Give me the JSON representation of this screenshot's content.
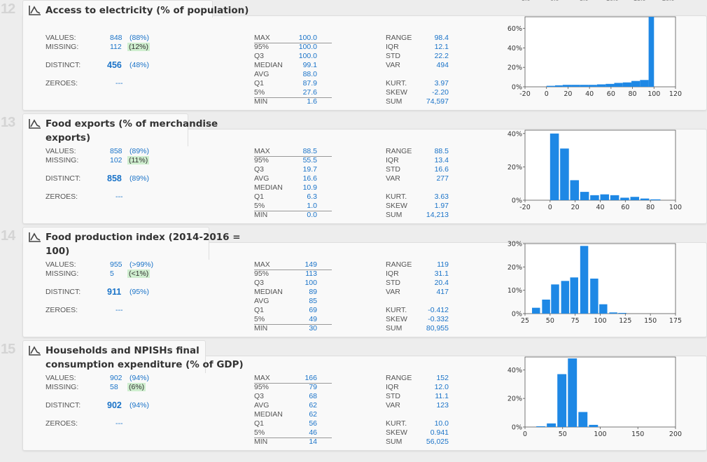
{
  "rows": [
    {
      "num": "12",
      "title": "Access to electricity (% of population)",
      "values_label": "VALUES:",
      "values": "848",
      "values_pct": "(88%)",
      "missing_label": "MISSING:",
      "missing": "112",
      "missing_pct": "(12%)",
      "distinct_label": "DISTINCT:",
      "distinct": "456",
      "distinct_pct": "(48%)",
      "zeroes_label": "ZEROES:",
      "zeroes": "---",
      "q": [
        [
          "MAX",
          "100.0"
        ],
        [
          "95%",
          "100.0"
        ],
        [
          "Q3",
          "100.0"
        ],
        [
          "MEDIAN",
          "99.1"
        ],
        [
          "AVG",
          "88.0"
        ],
        [
          "Q1",
          "87.9"
        ],
        [
          "5%",
          "27.6"
        ],
        [
          "MIN",
          "1.6"
        ]
      ],
      "s1": [
        [
          "RANGE",
          "98.4"
        ],
        [
          "IQR",
          "12.1"
        ],
        [
          "STD",
          "22.2"
        ],
        [
          "VAR",
          "494"
        ]
      ],
      "s2": [
        [
          "KURT.",
          "3.97"
        ],
        [
          "SKEW",
          "-2.20"
        ],
        [
          "SUM",
          "74,597"
        ]
      ],
      "chart_data": {
        "type": "bar",
        "xlim": [
          -20,
          120
        ],
        "xticks": [
          -20,
          0,
          20,
          40,
          60,
          80,
          100,
          120
        ],
        "ylim": [
          0,
          0.72
        ],
        "yticks": [
          {
            "v": 0,
            "l": "0%"
          },
          {
            "v": 0.2,
            "l": "20%"
          },
          {
            "v": 0.4,
            "l": "40%"
          },
          {
            "v": 0.6,
            "l": "60%"
          }
        ],
        "bins": [
          [
            0,
            8,
            0.01
          ],
          [
            8,
            15,
            0.015
          ],
          [
            15,
            23,
            0.02
          ],
          [
            23,
            31,
            0.02
          ],
          [
            31,
            39,
            0.02
          ],
          [
            39,
            47,
            0.02
          ],
          [
            47,
            55,
            0.025
          ],
          [
            55,
            63,
            0.03
          ],
          [
            63,
            71,
            0.04
          ],
          [
            71,
            79,
            0.045
          ],
          [
            79,
            87,
            0.06
          ],
          [
            87,
            95,
            0.07
          ],
          [
            95,
            100,
            0.72
          ]
        ]
      }
    },
    {
      "num": "13",
      "title": "Food exports (% of merchandise exports)",
      "title_line1": "Food exports (% of merchandise",
      "title_line2": "exports)",
      "values_label": "VALUES:",
      "values": "858",
      "values_pct": "(89%)",
      "missing_label": "MISSING:",
      "missing": "102",
      "missing_pct": "(11%)",
      "distinct_label": "DISTINCT:",
      "distinct": "858",
      "distinct_pct": "(89%)",
      "zeroes_label": "ZEROES:",
      "zeroes": "---",
      "q": [
        [
          "MAX",
          "88.5"
        ],
        [
          "95%",
          "55.5"
        ],
        [
          "Q3",
          "19.7"
        ],
        [
          "AVG",
          "16.6"
        ],
        [
          "MEDIAN",
          "10.9"
        ],
        [
          "Q1",
          "6.3"
        ],
        [
          "5%",
          "1.0"
        ],
        [
          "MIN",
          "0.0"
        ]
      ],
      "s1": [
        [
          "RANGE",
          "88.5"
        ],
        [
          "IQR",
          "13.4"
        ],
        [
          "STD",
          "16.6"
        ],
        [
          "VAR",
          "277"
        ]
      ],
      "s2": [
        [
          "KURT.",
          "3.63"
        ],
        [
          "SKEW",
          "1.97"
        ],
        [
          "SUM",
          "14,213"
        ]
      ],
      "chart_data": {
        "type": "bar",
        "xlim": [
          -20,
          100
        ],
        "xticks": [
          -20,
          0,
          20,
          40,
          60,
          80,
          100
        ],
        "ylim": [
          0,
          0.42
        ],
        "yticks": [
          {
            "v": 0,
            "l": "0%"
          },
          {
            "v": 0.2,
            "l": "20%"
          },
          {
            "v": 0.4,
            "l": "40%"
          }
        ],
        "bins": [
          [
            0,
            7,
            0.4
          ],
          [
            8,
            15,
            0.31
          ],
          [
            16,
            23,
            0.12
          ],
          [
            24,
            31,
            0.05
          ],
          [
            32,
            39,
            0.03
          ],
          [
            40,
            47,
            0.035
          ],
          [
            48,
            55,
            0.03
          ],
          [
            56,
            63,
            0.015
          ],
          [
            64,
            71,
            0.02
          ],
          [
            72,
            79,
            0.01
          ],
          [
            80,
            88,
            0.005
          ]
        ]
      }
    },
    {
      "num": "14",
      "title": "Food production index (2014-2016 = 100)",
      "title_line1": "Food production index (2014-2016 =",
      "title_line2": "100)",
      "values_label": "VALUES:",
      "values": "955",
      "values_pct": "(>99%)",
      "missing_label": "MISSING:",
      "missing": "5",
      "missing_pct": "(<1%)",
      "distinct_label": "DISTINCT:",
      "distinct": "911",
      "distinct_pct": "(95%)",
      "zeroes_label": "ZEROES:",
      "zeroes": "---",
      "q": [
        [
          "MAX",
          "149"
        ],
        [
          "95%",
          "113"
        ],
        [
          "Q3",
          "100"
        ],
        [
          "MEDIAN",
          "89"
        ],
        [
          "AVG",
          "85"
        ],
        [
          "Q1",
          "69"
        ],
        [
          "5%",
          "49"
        ],
        [
          "MIN",
          "30"
        ]
      ],
      "s1": [
        [
          "RANGE",
          "119"
        ],
        [
          "IQR",
          "31.1"
        ],
        [
          "STD",
          "20.4"
        ],
        [
          "VAR",
          "417"
        ]
      ],
      "s2": [
        [
          "KURT.",
          "-0.412"
        ],
        [
          "SKEW",
          "-0.332"
        ],
        [
          "SUM",
          "80,955"
        ]
      ],
      "chart_data": {
        "type": "bar",
        "xlim": [
          25,
          175
        ],
        "xticks": [
          25,
          50,
          75,
          100,
          125,
          150,
          175
        ],
        "ylim": [
          0,
          0.3
        ],
        "yticks": [
          {
            "v": 0,
            "l": "0%"
          },
          {
            "v": 0.1,
            "l": "10%"
          },
          {
            "v": 0.2,
            "l": "20%"
          },
          {
            "v": 0.3,
            "l": "30%"
          }
        ],
        "bins": [
          [
            32,
            40,
            0.025
          ],
          [
            42,
            50,
            0.06
          ],
          [
            51,
            59,
            0.125
          ],
          [
            61,
            69,
            0.14
          ],
          [
            70,
            78,
            0.155
          ],
          [
            80,
            88,
            0.29
          ],
          [
            90,
            98,
            0.15
          ],
          [
            99,
            107,
            0.04
          ],
          [
            109,
            117,
            0.005
          ],
          [
            118,
            126,
            0.003
          ]
        ]
      }
    },
    {
      "num": "15",
      "title": "Households and NPISHs final consumption expenditure (% of GDP)",
      "title_line1": "Households and NPISHs final",
      "title_line2": "consumption expenditure (% of GDP)",
      "values_label": "VALUES:",
      "values": "902",
      "values_pct": "(94%)",
      "missing_label": "MISSING:",
      "missing": "58",
      "missing_pct": "(6%)",
      "distinct_label": "DISTINCT:",
      "distinct": "902",
      "distinct_pct": "(94%)",
      "zeroes_label": "ZEROES:",
      "zeroes": "---",
      "q": [
        [
          "MAX",
          "166"
        ],
        [
          "95%",
          "79"
        ],
        [
          "Q3",
          "68"
        ],
        [
          "AVG",
          "62"
        ],
        [
          "MEDIAN",
          "62"
        ],
        [
          "Q1",
          "56"
        ],
        [
          "5%",
          "46"
        ],
        [
          "MIN",
          "14"
        ]
      ],
      "s1": [
        [
          "RANGE",
          "152"
        ],
        [
          "IQR",
          "12.0"
        ],
        [
          "STD",
          "11.1"
        ],
        [
          "VAR",
          "123"
        ]
      ],
      "s2": [
        [
          "KURT.",
          "10.0"
        ],
        [
          "SKEW",
          "0.941"
        ],
        [
          "SUM",
          "56,025"
        ]
      ],
      "chart_data": {
        "type": "bar",
        "xlim": [
          0,
          200
        ],
        "xticks": [
          0,
          50,
          100,
          150,
          200
        ],
        "ylim": [
          0,
          0.49
        ],
        "yticks": [
          {
            "v": 0,
            "l": "0%"
          },
          {
            "v": 0.2,
            "l": "20%"
          },
          {
            "v": 0.4,
            "l": "40%"
          }
        ],
        "bins": [
          [
            15,
            27,
            0.005
          ],
          [
            29,
            41,
            0.025
          ],
          [
            43,
            55,
            0.37
          ],
          [
            57,
            69,
            0.48
          ],
          [
            71,
            83,
            0.105
          ],
          [
            85,
            97,
            0.015
          ]
        ]
      }
    }
  ],
  "colors": {
    "bar": "#1e88e5",
    "value": "#1a73c8",
    "missing_bg": "#cfeecf"
  }
}
